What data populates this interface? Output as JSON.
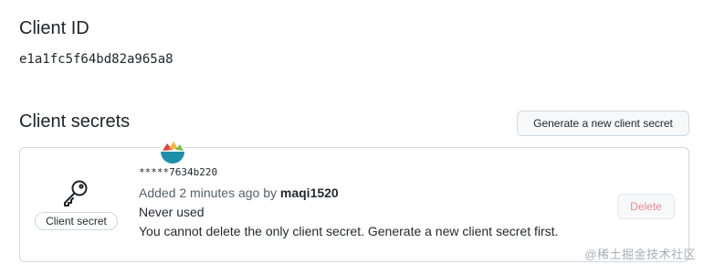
{
  "client_id": {
    "heading": "Client ID",
    "value": "e1a1fc5f64bd82a965a8"
  },
  "client_secrets": {
    "heading": "Client secrets",
    "generate_button_label": "Generate a new client secret",
    "secret": {
      "badge_label": "Client secret",
      "masked_value": "*****7634b220",
      "added_prefix": "Added 2 minutes ago by",
      "added_by": "maqi1520",
      "usage": "Never used",
      "warning": "You cannot delete the only client secret. Generate a new client secret first.",
      "delete_button_label": "Delete",
      "icon": "key-icon"
    }
  },
  "watermark": {
    "text": "@稀土掘金技术社区"
  },
  "colors": {
    "border": "#d0d7de",
    "button_bg": "#f6f8fa",
    "text_primary": "#1f2328",
    "text_muted": "#57606a",
    "danger_disabled": "#e58b91"
  }
}
